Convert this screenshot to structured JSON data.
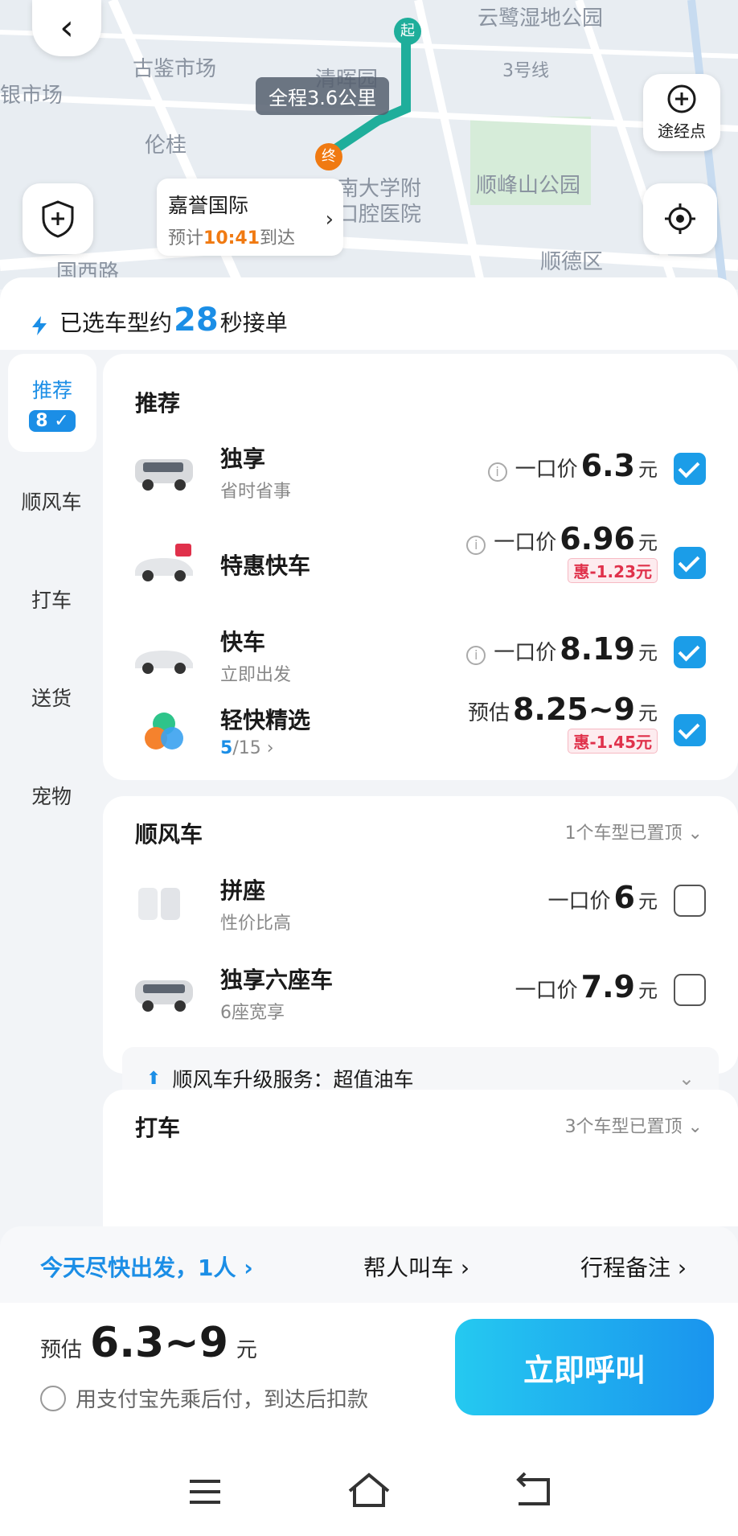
{
  "map": {
    "labels": [
      "古鉴市场",
      "银市场",
      "清晖园",
      "云鹭湿地公园",
      "3号线",
      "顺峰山公园",
      "南大学附",
      "口腔医院",
      "顺德区",
      "国西路",
      "伦桂"
    ],
    "route_distance": "全程3.6公里",
    "start_marker": "起",
    "end_marker": "终",
    "waypoint_label": "途经点",
    "destination": {
      "name": "嘉誉国际",
      "eta_prefix": "预计",
      "eta_time": "10:41",
      "eta_suffix": "到达"
    }
  },
  "header": {
    "prefix": "已选车型约",
    "seconds": "28",
    "suffix": "秒接单"
  },
  "sidebar": {
    "items": [
      {
        "label": "推荐",
        "badge": "8"
      },
      {
        "label": "顺风车"
      },
      {
        "label": "打车"
      },
      {
        "label": "送货"
      },
      {
        "label": "宠物"
      }
    ]
  },
  "recommend": {
    "title": "推荐",
    "rows": [
      {
        "name": "独享",
        "desc": "省时省事",
        "price_prefix": "一口价",
        "price": "6.3",
        "unit": "元",
        "checked": true
      },
      {
        "name": "特惠快车",
        "desc": "",
        "price_prefix": "一口价",
        "price": "6.96",
        "unit": "元",
        "discount": "惠-1.23元",
        "checked": true
      },
      {
        "name": "快车",
        "desc": "立即出发",
        "price_prefix": "一口价",
        "price": "8.19",
        "unit": "元",
        "checked": true
      },
      {
        "name": "轻快精选",
        "desc_count": "5",
        "desc_total": "/15 ›",
        "price_prefix": "预估",
        "price": "8.25~9",
        "unit": "元",
        "discount": "惠-1.45元",
        "checked": true
      }
    ]
  },
  "carpool": {
    "title": "顺风车",
    "pinned": "1个车型已置顶",
    "rows": [
      {
        "name": "拼座",
        "desc": "性价比高",
        "price_prefix": "一口价",
        "price": "6",
        "unit": "元",
        "checked": false
      },
      {
        "name": "独享六座车",
        "desc": "6座宽享",
        "price_prefix": "一口价",
        "price": "7.9",
        "unit": "元",
        "checked": false
      }
    ],
    "upgrade": "顺风车升级服务：超值油车"
  },
  "taxi": {
    "title": "打车",
    "pinned": "3个车型已置顶"
  },
  "options": {
    "departure": "今天尽快出发，1人",
    "call_for_others": "帮人叫车",
    "notes": "行程备注"
  },
  "footer": {
    "estimate_prefix": "预估",
    "estimate_range": "6.3~9",
    "estimate_unit": "元",
    "alipay_text": "用支付宝先乘后付，到达后扣款",
    "call_button": "立即呼叫"
  },
  "colors": {
    "accent": "#1b8ee6",
    "discount": "#e0314b",
    "eta": "#f07a12",
    "route": "#1fae9b"
  }
}
